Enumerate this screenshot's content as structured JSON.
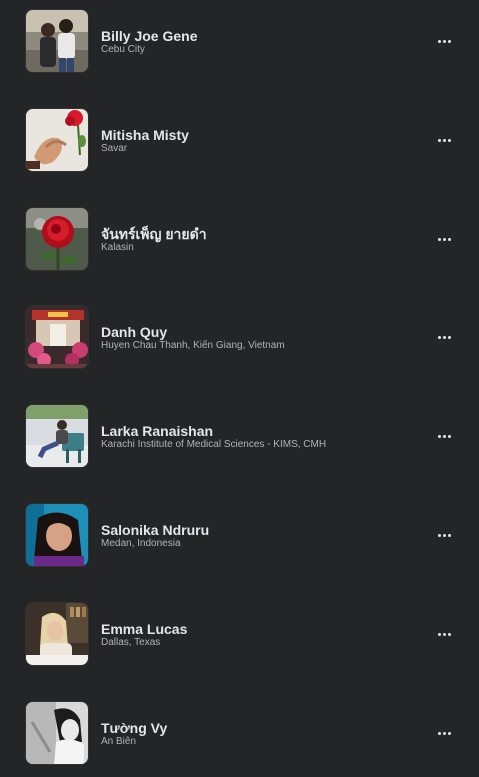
{
  "friends": [
    {
      "name": "Billy Joe Gene",
      "subtitle": "Cebu City",
      "more_icon": "more-horizontal-icon"
    },
    {
      "name": "Mitisha Misty",
      "subtitle": "Savar",
      "more_icon": "more-horizontal-icon"
    },
    {
      "name": "จันทร์เพ็ญ ยายดำ",
      "subtitle": "Kalasin",
      "more_icon": "more-horizontal-icon"
    },
    {
      "name": "Danh Quy",
      "subtitle": "Huyen Chau Thanh, Kiến Giang, Vietnam",
      "more_icon": "more-horizontal-icon"
    },
    {
      "name": "Larka Ranaishan",
      "subtitle": "Karachi Institute of Medical Sciences - KIMS, CMH",
      "more_icon": "more-horizontal-icon"
    },
    {
      "name": "Salonika Ndruru",
      "subtitle": "Medan, Indonesia",
      "more_icon": "more-horizontal-icon"
    },
    {
      "name": "Emma Lucas",
      "subtitle": "Dallas, Texas",
      "more_icon": "more-horizontal-icon"
    },
    {
      "name": "Tường Vy",
      "subtitle": "An Biên",
      "more_icon": "more-horizontal-icon"
    }
  ],
  "colors": {
    "background": "#242526",
    "primary_text": "#e4e6eb",
    "secondary_text": "#b0b3b8"
  }
}
